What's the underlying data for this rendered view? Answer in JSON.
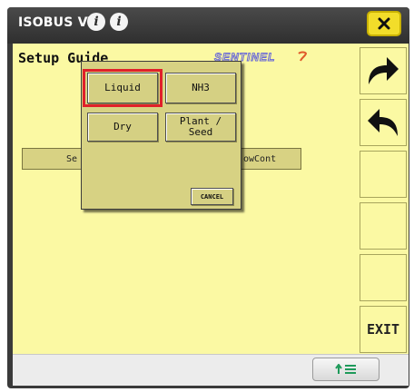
{
  "header": {
    "title": "ISOBUS VT",
    "info_icons": [
      "info-icon",
      "info-icon"
    ],
    "close_icon": "close-icon"
  },
  "screen": {
    "title": "Setup Guide",
    "brand": "SENTINEL",
    "background_buttons": {
      "left_label": "Se",
      "right_label": "owCont"
    }
  },
  "popup": {
    "buttons": [
      {
        "label": "Liquid",
        "selected": true
      },
      {
        "label": "NH3"
      },
      {
        "label": "Dry"
      },
      {
        "label": "Plant / Seed",
        "line1": "Plant /",
        "line2": "Seed"
      }
    ],
    "cancel_label": "CANCEL"
  },
  "softkeys": {
    "next_icon": "arrow-right-icon",
    "back_icon": "arrow-left-icon",
    "exit_label": "EXIT"
  },
  "bottom": {
    "button_icon": "softkey-list-icon"
  },
  "colors": {
    "screen_bg": "#fbf9a3",
    "button_bg": "#d5d083",
    "selected_outline": "#e0202a",
    "close_bg": "#f2dd2a",
    "frame": "#3a3a3a"
  }
}
